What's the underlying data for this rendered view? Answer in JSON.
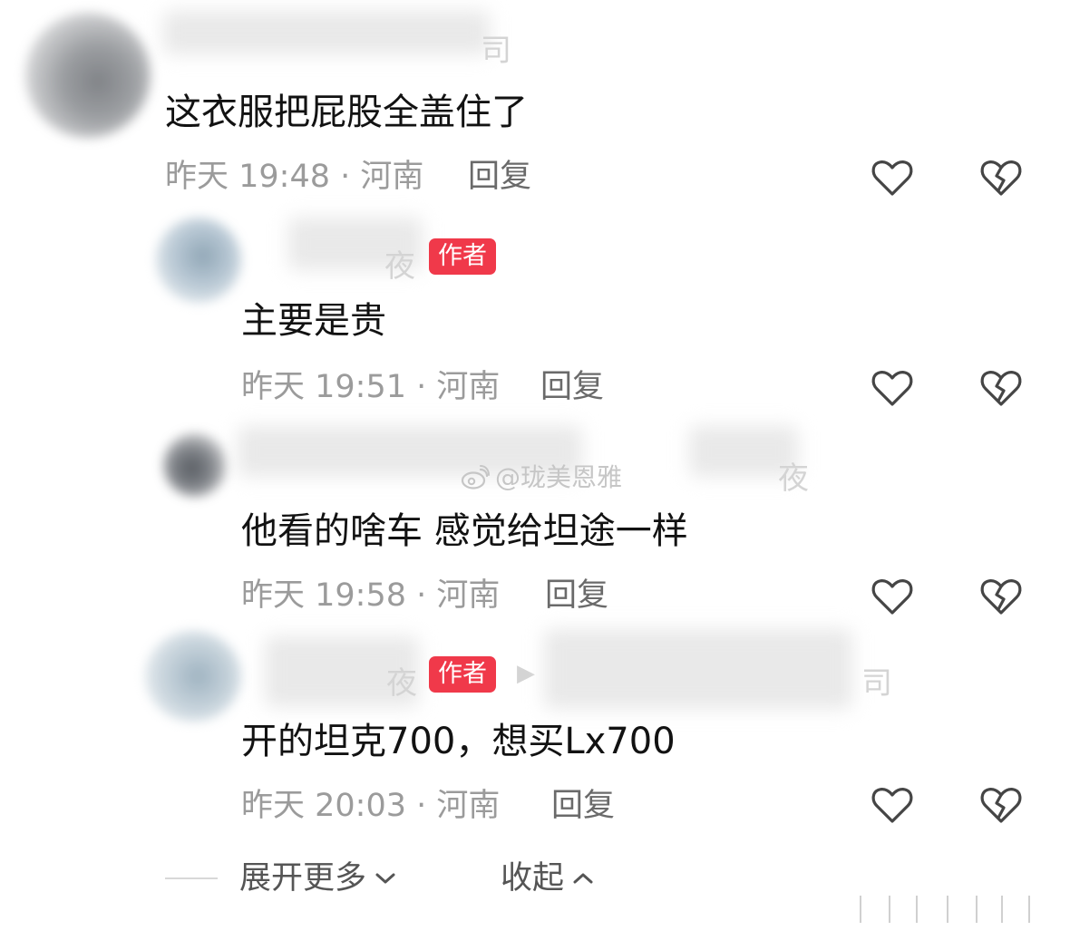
{
  "colors": {
    "badge": "#f0394a",
    "meta_text": "#9b9b9b",
    "reply_text": "#6a6a6a",
    "icon_stroke": "#454545"
  },
  "comments": [
    {
      "text": "这衣服把屁股全盖住了",
      "time": "昨天 19:48 · 河南",
      "reply_label": "回复",
      "like_icon": "heart-icon",
      "dislike_icon": "broken-heart-icon"
    },
    {
      "badge": "作者",
      "text": "主要是贵",
      "time": "昨天 19:51 · 河南",
      "reply_label": "回复",
      "like_icon": "heart-icon",
      "dislike_icon": "broken-heart-icon"
    },
    {
      "text": "他看的啥车 感觉给坦途一样",
      "time": "昨天 19:58 · 河南",
      "reply_label": "回复",
      "like_icon": "heart-icon",
      "dislike_icon": "broken-heart-icon"
    },
    {
      "badge": "作者",
      "text": "开的坦克700，想买Lx700",
      "time": "昨天 20:03 · 河南",
      "reply_label": "回复",
      "like_icon": "heart-icon",
      "dislike_icon": "broken-heart-icon"
    }
  ],
  "footer": {
    "expand_label": "展开更多",
    "collapse_label": "收起"
  },
  "watermark": {
    "text": "@珑美恩雅",
    "icon": "weibo-logo-icon"
  }
}
